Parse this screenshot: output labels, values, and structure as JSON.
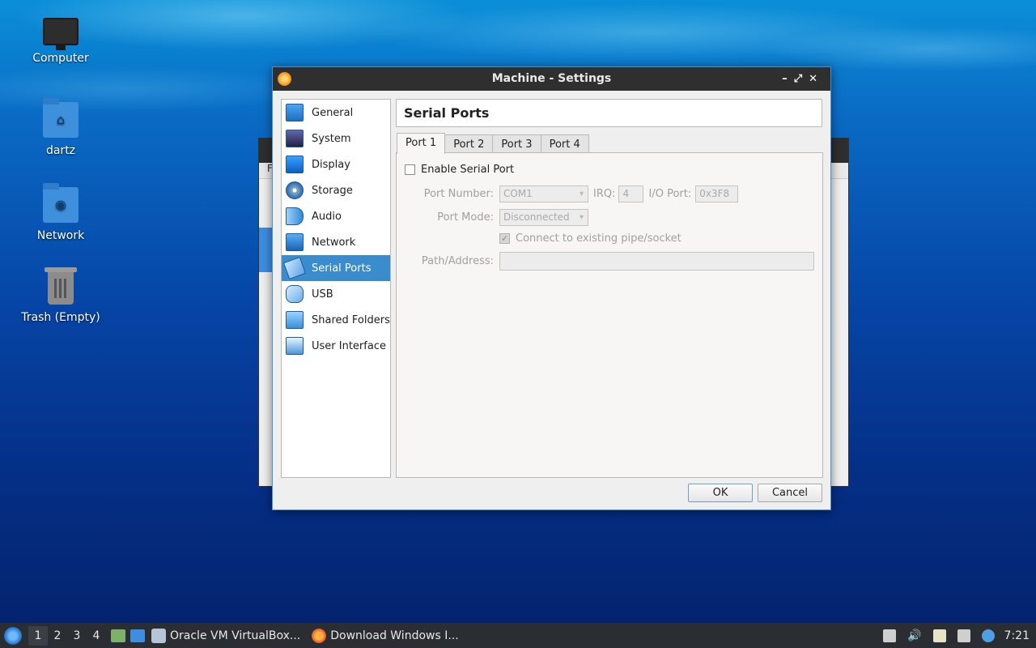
{
  "desktop": {
    "icons": [
      {
        "label": "Computer",
        "icon": "computer-icon"
      },
      {
        "label": "dartz",
        "icon": "home-folder-icon"
      },
      {
        "label": "Network",
        "icon": "network-folder-icon"
      },
      {
        "label": "Trash (Empty)",
        "icon": "trash-icon"
      }
    ]
  },
  "background_window": {
    "menu_fragment": "F"
  },
  "dialog": {
    "title": "Machine - Settings",
    "controls": {
      "minimize": "–",
      "maximize": "⤢",
      "close": "✕"
    },
    "sidebar": [
      {
        "label": "General",
        "icon": "general-icon"
      },
      {
        "label": "System",
        "icon": "system-icon"
      },
      {
        "label": "Display",
        "icon": "display-icon"
      },
      {
        "label": "Storage",
        "icon": "storage-icon"
      },
      {
        "label": "Audio",
        "icon": "audio-icon"
      },
      {
        "label": "Network",
        "icon": "network-icon"
      },
      {
        "label": "Serial Ports",
        "icon": "serial-ports-icon",
        "active": true
      },
      {
        "label": "USB",
        "icon": "usb-icon"
      },
      {
        "label": "Shared Folders",
        "icon": "shared-folders-icon"
      },
      {
        "label": "User Interface",
        "icon": "user-interface-icon"
      }
    ],
    "section_title": "Serial Ports",
    "tabs": [
      {
        "label": "Port 1",
        "active": true
      },
      {
        "label": "Port 2"
      },
      {
        "label": "Port 3"
      },
      {
        "label": "Port 4"
      }
    ],
    "form": {
      "enable_label": "Enable Serial Port",
      "enable_checked": false,
      "port_number_label": "Port Number:",
      "port_number_value": "COM1",
      "irq_label": "IRQ:",
      "irq_value": "4",
      "io_port_label": "I/O Port:",
      "io_port_value": "0x3F8",
      "port_mode_label": "Port Mode:",
      "port_mode_value": "Disconnected",
      "connect_label": "Connect to existing pipe/socket",
      "connect_checked": true,
      "path_label": "Path/Address:",
      "path_value": ""
    },
    "buttons": {
      "ok": "OK",
      "cancel": "Cancel"
    }
  },
  "taskbar": {
    "workspaces": [
      "1",
      "2",
      "3",
      "4"
    ],
    "active_workspace": "1",
    "tasks": [
      {
        "label": "Oracle VM VirtualBox...",
        "icon": "virtualbox-icon"
      },
      {
        "label": "Download Windows I...",
        "icon": "firefox-icon"
      }
    ],
    "clock": "7:21"
  },
  "colors": {
    "accent": "#3b8ccc",
    "titlebar": "#2f2f2f",
    "taskbar": "#2a2d31"
  }
}
